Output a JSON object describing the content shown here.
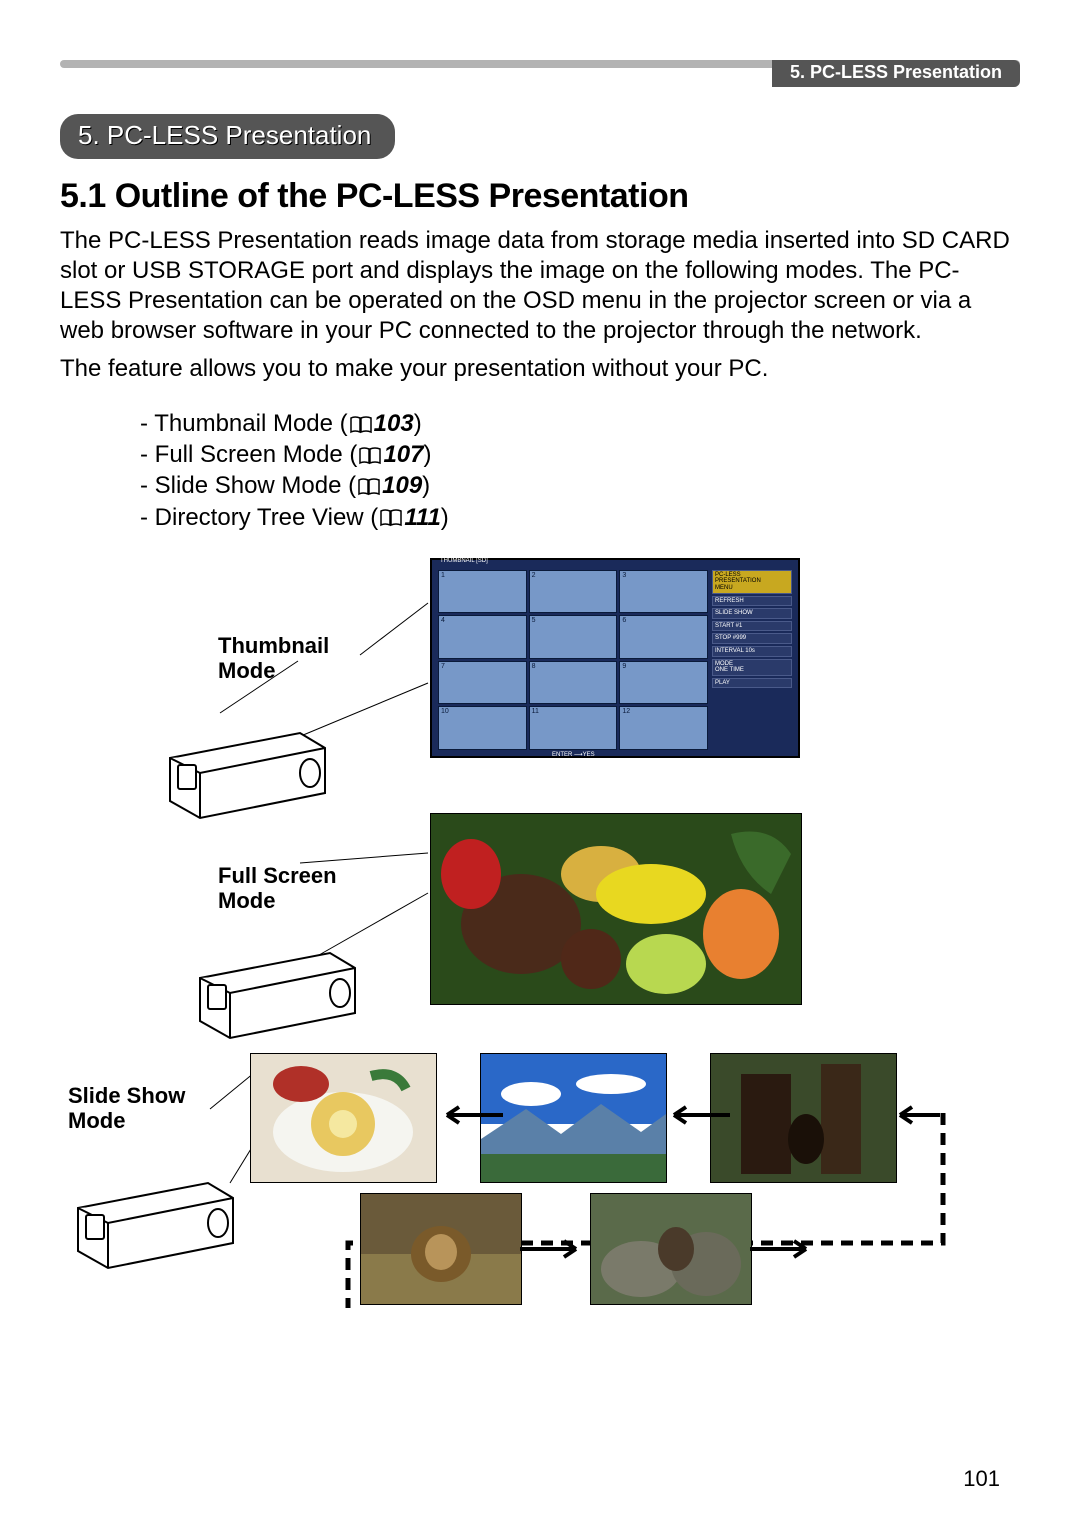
{
  "header": {
    "breadcrumb": "5. PC-LESS Presentation"
  },
  "section": {
    "pill": "5. PC-LESS Presentation",
    "heading": "5.1 Outline of the PC-LESS Presentation"
  },
  "paragraphs": {
    "p1": "The PC-LESS Presentation reads image data from storage media inserted into SD CARD slot or USB STORAGE port and displays the image on the following modes. The PC-LESS Presentation can be operated on the OSD menu in the projector screen or via a web browser software in your PC connected to the projector through the network.",
    "p2": "The feature allows you to make your presentation without your PC."
  },
  "modes": [
    {
      "label": "Thumbnail Mode",
      "ref": "103"
    },
    {
      "label": "Full Screen Mode",
      "ref": "107"
    },
    {
      "label": "Slide Show Mode",
      "ref": "109"
    },
    {
      "label": "Directory Tree View",
      "ref": "111"
    }
  ],
  "diagram": {
    "thumbnail_label": "Thumbnail\nMode",
    "fullscreen_label": "Full Screen\nMode",
    "slideshow_label": "Slide Show\nMode",
    "osd": {
      "title": "THUMBNAIL [SD]",
      "items": [
        "PC-LESS\nPRESENTATION\nMENU",
        "REFRESH",
        "SLIDE SHOW",
        "START    #1",
        "STOP    #999",
        "INTERVAL  10s",
        "MODE\n      ONE TIME",
        "PLAY"
      ],
      "footer": "ENTER ⟶YES"
    },
    "thumb_numbers": [
      "1",
      "2",
      "3",
      "4",
      "5",
      "6",
      "7",
      "8",
      "9",
      "10",
      "11",
      "12"
    ]
  },
  "page_number": "101"
}
